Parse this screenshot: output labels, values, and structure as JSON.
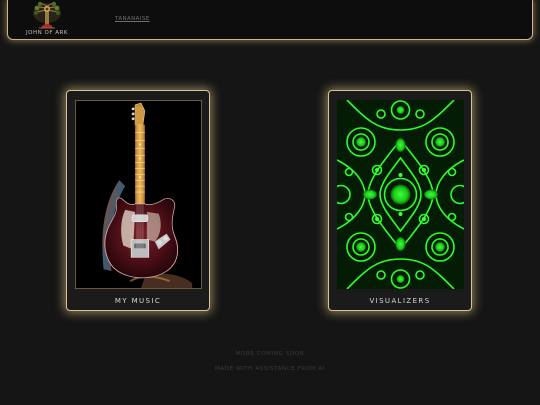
{
  "header": {
    "logo_text": "JOHN OF ARK",
    "nav_link": "TANANAISE"
  },
  "cards": [
    {
      "label": "MY MUSIC",
      "image": "electric-guitar-photo"
    },
    {
      "label": "VISUALIZERS",
      "image": "green-kaleidoscope-pattern"
    }
  ],
  "footer": {
    "line1": "MORE COMING SOON",
    "line2": "MADE WITH ASSISTANCE FROM AI"
  },
  "colors": {
    "background": "#151515",
    "card_glow": "#e6cd93",
    "visualizer_green": "#22ff22"
  }
}
